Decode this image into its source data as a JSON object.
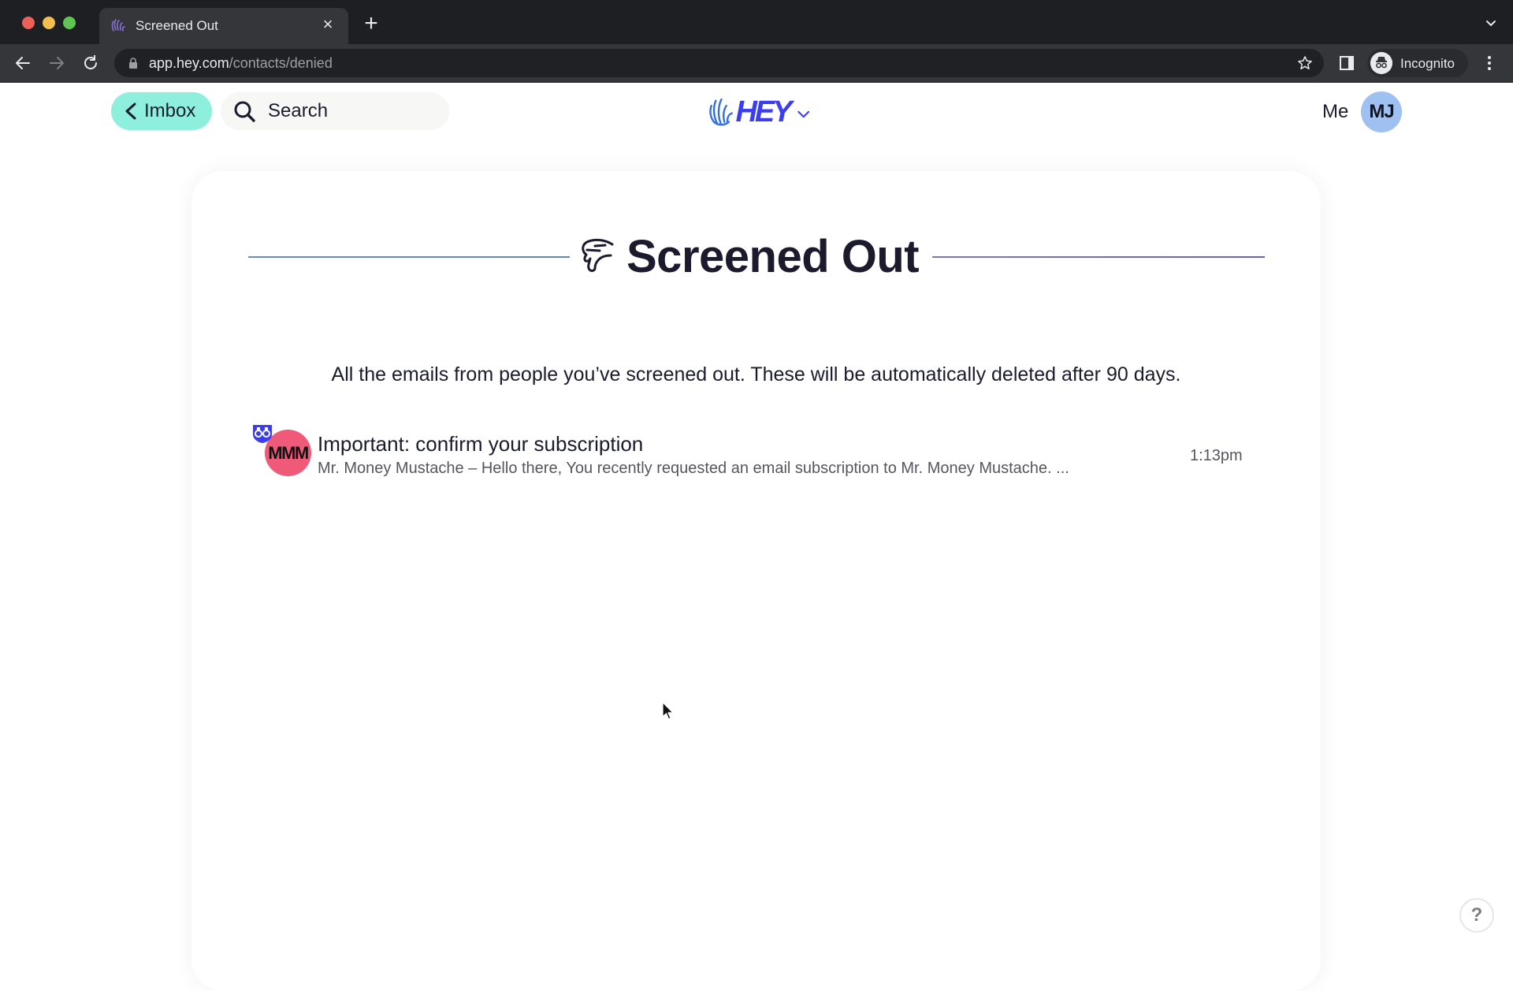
{
  "browser": {
    "tab": {
      "title": "Screened Out",
      "favicon": "hey-hand-icon"
    },
    "new_tab_label": "+",
    "close_tab_label": "×",
    "url": {
      "host": "app.hey.com",
      "path": "/contacts/denied"
    },
    "profile_label": "Incognito"
  },
  "header": {
    "back_button_label": "Imbox",
    "search_label": "Search",
    "logo_text": "HEY",
    "me_label": "Me",
    "avatar_initials": "MJ",
    "colors": {
      "imbox_bg": "#8ef0dc",
      "logo": "#3a3ef0",
      "avatar_bg": "#9fc1f2"
    }
  },
  "main": {
    "title": "Screened Out",
    "title_icon": "thumbs-down-icon",
    "subtitle": "All the emails from people you’ve screened out. These will be automatically deleted after 90 days.",
    "emails": [
      {
        "avatar_initials": "MMM",
        "avatar_color": "#ee5a78",
        "badge_icon": "binoculars-icon",
        "subject": "Important: confirm your subscription",
        "snippet": "Mr. Money Mustache – Hello there, You recently requested an email subscription to Mr. Money Mustache. ...",
        "time": "1:13pm"
      }
    ]
  },
  "help": {
    "label": "?"
  }
}
